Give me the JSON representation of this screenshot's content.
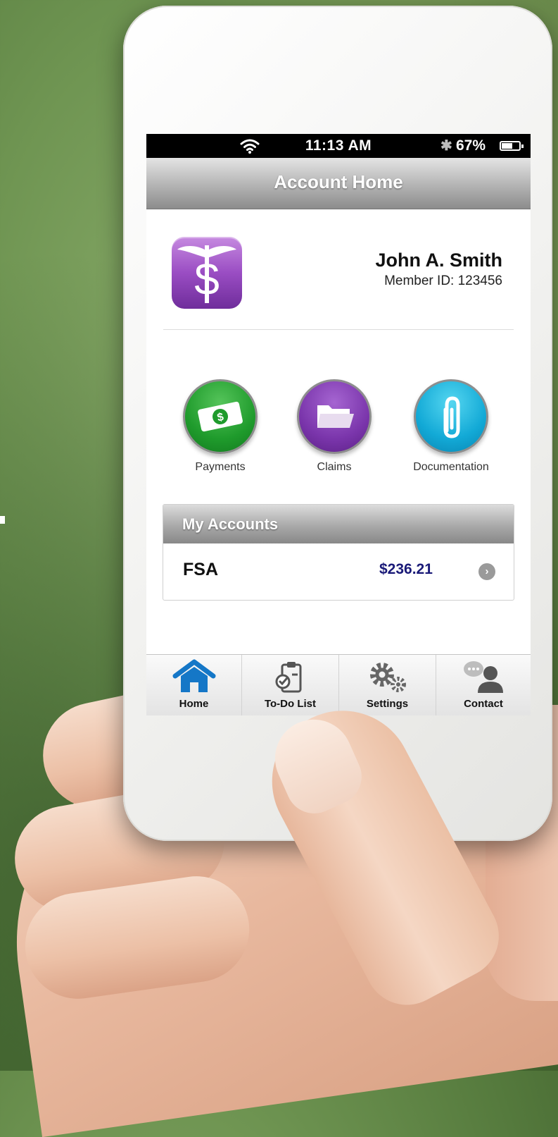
{
  "status_bar": {
    "time": "11:13 AM",
    "battery_percent": "67%",
    "battery_level": 0.67,
    "icons": [
      "wifi-icon",
      "bluetooth-icon",
      "battery-icon"
    ]
  },
  "nav_bar": {
    "title": "Account Home"
  },
  "profile": {
    "name": "John A. Smith",
    "member_id": "Member ID: 123456",
    "logo_icon": "caduceus-dollar-icon"
  },
  "actions": [
    {
      "label": "Payments",
      "icon": "money-icon",
      "color": "#1f9b2c"
    },
    {
      "label": "Claims",
      "icon": "folder-icon",
      "color": "#7a35ab"
    },
    {
      "label": "Documentation",
      "icon": "paperclip-icon",
      "color": "#12a9d6"
    }
  ],
  "accounts": {
    "header": "My Accounts",
    "rows": [
      {
        "name": "FSA",
        "amount": "$236.21",
        "icon": "chevron-right-icon"
      }
    ]
  },
  "tab_bar": {
    "tabs": [
      {
        "label": "Home",
        "icon": "home-icon",
        "active": true,
        "color": "#1577c7"
      },
      {
        "label": "To-Do List",
        "icon": "clipboard-icon"
      },
      {
        "label": "Settings",
        "icon": "gear-icon"
      },
      {
        "label": "Contact",
        "icon": "contact-icon"
      }
    ]
  }
}
